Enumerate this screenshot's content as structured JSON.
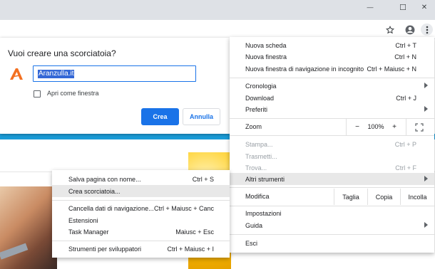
{
  "window": {
    "minimize_glyph": "—",
    "maximize_glyph": "☐",
    "close_glyph": "✕"
  },
  "toolbar": {
    "bookmark_icon": "star-icon",
    "profile_icon": "account-icon",
    "menu_icon": "kebab-menu-icon"
  },
  "dialog": {
    "title": "Vuoi creare una scorciatoia?",
    "name_value": "Aranzulla.it",
    "open_as_window_label": "Apri come finestra",
    "open_as_window_checked": false,
    "create_label": "Crea",
    "cancel_label": "Annulla",
    "logo_color": "#f37021"
  },
  "menu": {
    "new_tab": {
      "label": "Nuova scheda",
      "shortcut": "Ctrl + T"
    },
    "new_window": {
      "label": "Nuova finestra",
      "shortcut": "Ctrl + N"
    },
    "incognito": {
      "label": "Nuova finestra di navigazione in incognito",
      "shortcut": "Ctrl + Maiusc + N"
    },
    "history": {
      "label": "Cronologia"
    },
    "downloads": {
      "label": "Download",
      "shortcut": "Ctrl + J"
    },
    "bookmarks": {
      "label": "Preferiti"
    },
    "zoom": {
      "label": "Zoom",
      "minus": "−",
      "value": "100%",
      "plus": "+",
      "fullscreen_icon": "fullscreen-icon"
    },
    "print": {
      "label": "Stampa...",
      "shortcut": "Ctrl + P"
    },
    "cast": {
      "label": "Trasmetti..."
    },
    "find": {
      "label": "Trova...",
      "shortcut": "Ctrl + F"
    },
    "more_tools": {
      "label": "Altri strumenti"
    },
    "edit": {
      "label": "Modifica",
      "cut": "Taglia",
      "copy": "Copia",
      "paste": "Incolla"
    },
    "settings": {
      "label": "Impostazioni"
    },
    "help": {
      "label": "Guida"
    },
    "exit": {
      "label": "Esci"
    }
  },
  "submenu": {
    "save_page": {
      "label": "Salva pagina con nome...",
      "shortcut": "Ctrl + S"
    },
    "create_shortcut": {
      "label": "Crea scorciatoia..."
    },
    "clear_data": {
      "label": "Cancella dati di navigazione...",
      "shortcut": "Ctrl + Maiusc + Canc"
    },
    "extensions": {
      "label": "Estensioni"
    },
    "task_manager": {
      "label": "Task Manager",
      "shortcut": "Maiusc + Esc"
    },
    "dev_tools": {
      "label": "Strumenti per sviluppatori",
      "shortcut": "Ctrl + Maiusc + I"
    }
  }
}
